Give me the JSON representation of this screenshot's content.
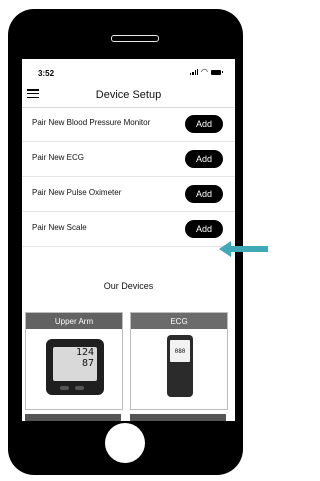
{
  "status_bar": {
    "time": "3:52"
  },
  "nav": {
    "title": "Device Setup"
  },
  "pair_rows": [
    {
      "label": "Pair New Blood Pressure Monitor",
      "button": "Add"
    },
    {
      "label": "Pair New ECG",
      "button": "Add"
    },
    {
      "label": "Pair New Pulse Oximeter",
      "button": "Add"
    },
    {
      "label": "Pair New Scale",
      "button": "Add"
    }
  ],
  "our_devices": {
    "title": "Our Devices",
    "cards": [
      {
        "label": "Upper Arm",
        "readout": [
          "124",
          "87"
        ]
      },
      {
        "label": "ECG",
        "readout": [
          "080"
        ]
      }
    ]
  },
  "colors": {
    "highlight_arrow": "#3fa9b8",
    "button": "#000000",
    "card_header": "#626262"
  }
}
